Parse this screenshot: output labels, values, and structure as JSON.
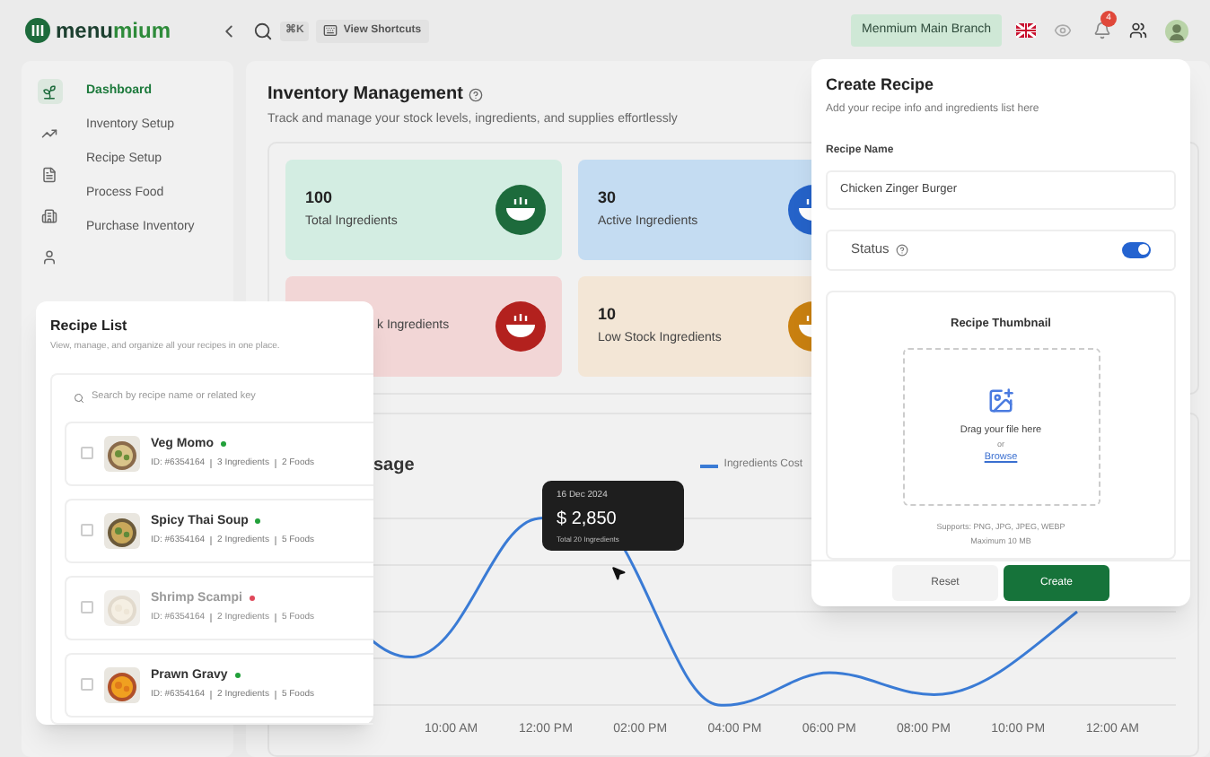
{
  "topbar": {
    "logo_main": "menu",
    "logo_accent": "mium",
    "shortcut_key": "⌘K",
    "shortcuts_label": "View Shortcuts",
    "branch": "Menmium Main Branch",
    "notification_count": "4"
  },
  "sidebar": {
    "items": [
      {
        "label": "Dashboard",
        "selected": true
      },
      {
        "label": "Inventory Setup",
        "selected": false
      },
      {
        "label": "Recipe Setup",
        "selected": false
      },
      {
        "label": "Process Food",
        "selected": false
      },
      {
        "label": "Purchase Inventory",
        "selected": false
      }
    ]
  },
  "main": {
    "title": "Inventory Management",
    "subtitle": "Track and manage your stock levels, ingredients, and supplies effortlessly",
    "stats": [
      {
        "value": "100",
        "label": "Total Ingredients",
        "color": "#d3ede2"
      },
      {
        "value": "30",
        "label": "Active Ingredients",
        "color": "#c4dcf2"
      },
      {
        "label": "k Ingredients",
        "color": "#f2d6d6"
      },
      {
        "value": "10",
        "label": "Low Stock Ingredients",
        "color": "#f3e6d6"
      }
    ],
    "chart": {
      "title": "sage",
      "legend": "Ingredients Cost",
      "x_labels": [
        "10:00 AM",
        "12:00 PM",
        "02:00 PM",
        "04:00 PM",
        "06:00 PM",
        "08:00 PM",
        "10:00 PM",
        "12:00 AM"
      ],
      "tooltip": {
        "date": "16 Dec 2024",
        "amount": "$ 2,850",
        "note": "Total 20 Ingredients"
      }
    }
  },
  "recipe_list": {
    "title": "Recipe List",
    "subtitle": "View, manage, and organize all your recipes in one place.",
    "search": {
      "placeholder": "Search by recipe name or related key"
    },
    "recipes": [
      {
        "name": "Veg Momo",
        "active": true,
        "id": "ID: #6354164",
        "ingredients": "3 Ingredients",
        "foods": "2 Foods",
        "checked": false
      },
      {
        "name": "Spicy Thai Soup",
        "active": true,
        "id": "ID: #6354164",
        "ingredients": "2 Ingredients",
        "foods": "5 Foods",
        "checked": false
      },
      {
        "name": "Shrimp Scampi",
        "active": false,
        "id": "ID: #6354164",
        "ingredients": "2 Ingredients",
        "foods": "5 Foods",
        "checked": false
      },
      {
        "name": "Prawn Gravy",
        "active": true,
        "id": "ID: #6354164",
        "ingredients": "2 Ingredients",
        "foods": "5 Foods",
        "checked": false
      }
    ]
  },
  "create_recipe": {
    "title": "Create Recipe",
    "subtitle": "Add your recipe info and ingredients list here",
    "name_label": "Recipe Name",
    "name_value": "Chicken Zinger Burger",
    "status_label": "Status",
    "status_on": true,
    "thumbnail": {
      "title": "Recipe Thumbnail",
      "drag_text": "Drag your file here",
      "or_text": "or",
      "browse": "Browse",
      "supports": "Supports: PNG, JPG, JPEG, WEBP",
      "max_size": "Maximum 10 MB"
    },
    "buttons": [
      {
        "label": "Reset",
        "kind": "secondary"
      },
      {
        "label": "Create",
        "kind": "primary"
      }
    ]
  }
}
